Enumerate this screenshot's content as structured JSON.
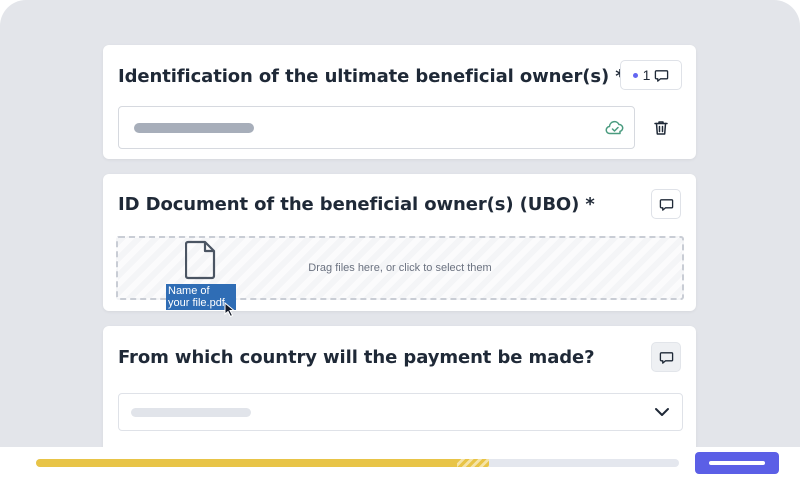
{
  "colors": {
    "accent": "#5b5fe6",
    "progress": "#e8c447",
    "success": "#4a9b7f",
    "notification_dot": "#6366f1",
    "file_selection": "#2f6db5"
  },
  "cards": [
    {
      "title": "Identification of the ultimate beneficial owner(s) *",
      "comment_count": "1",
      "icons": [
        "comment-icon",
        "cloud-check-icon",
        "trash-icon"
      ]
    },
    {
      "title": "ID Document of the beneficial owner(s) (UBO) *",
      "dropzone_text": "Drag files here, or click to select them",
      "file_name": "Name of your file.pdf",
      "icons": [
        "comment-icon",
        "file-icon",
        "cursor-icon"
      ]
    },
    {
      "title": "From which country will the payment be made?",
      "icons": [
        "comment-icon",
        "chevron-down-icon"
      ]
    }
  ],
  "progress": {
    "completed_fraction": 0.655,
    "pending_fraction": 0.05
  }
}
